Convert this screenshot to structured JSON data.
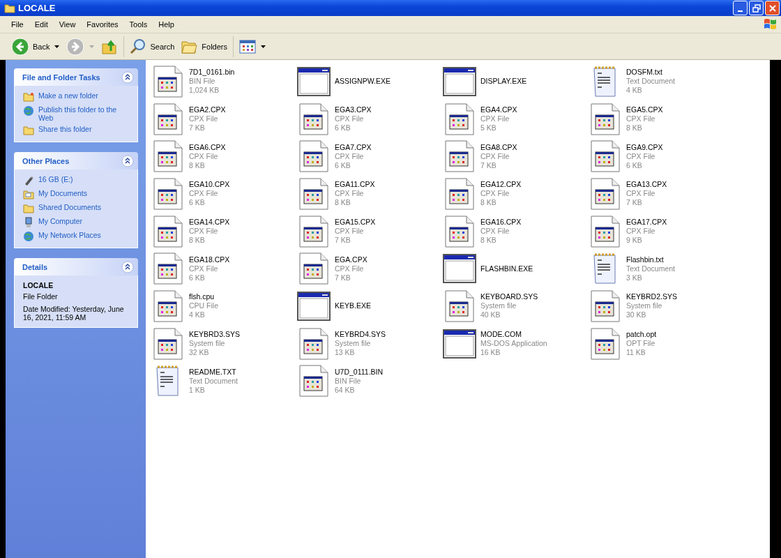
{
  "window": {
    "title": "LOCALE"
  },
  "menu": [
    "File",
    "Edit",
    "View",
    "Favorites",
    "Tools",
    "Help"
  ],
  "toolbar": [
    {
      "kind": "back",
      "label": "Back",
      "disabled": false
    },
    {
      "kind": "forward",
      "disabled": true
    },
    {
      "kind": "up"
    },
    {
      "kind": "search",
      "label": "Search"
    },
    {
      "kind": "folders",
      "label": "Folders"
    },
    {
      "kind": "views"
    }
  ],
  "sidebar": {
    "panels": [
      {
        "kind": "links",
        "title": "File and Folder Tasks",
        "items": [
          {
            "kind": "new-folder",
            "label": "Make a new folder"
          },
          {
            "kind": "publish",
            "label": "Publish this folder to the Web"
          },
          {
            "kind": "share",
            "label": "Share this folder"
          }
        ]
      },
      {
        "kind": "links",
        "title": "Other Places",
        "items": [
          {
            "kind": "drive",
            "label": "16 GB (E:)"
          },
          {
            "kind": "documents",
            "label": "My Documents"
          },
          {
            "kind": "shared",
            "label": "Shared Documents"
          },
          {
            "kind": "computer",
            "label": "My Computer"
          },
          {
            "kind": "network",
            "label": "My Network Places"
          }
        ]
      },
      {
        "kind": "details",
        "title": "Details",
        "name": "LOCALE",
        "type": "File Folder",
        "modified": "Date Modified: Yesterday, June 16, 2021, 11:59 AM"
      }
    ]
  },
  "files": [
    {
      "kind": "generic",
      "name": "7D1_0161.bin",
      "type": "BIN File",
      "size": "1,024 KB"
    },
    {
      "kind": "exe",
      "name": "ASSIGNPW.EXE"
    },
    {
      "kind": "exe",
      "name": "DISPLAY.EXE"
    },
    {
      "kind": "text",
      "name": "DOSFM.txt",
      "type": "Text Document",
      "size": "4 KB"
    },
    {
      "kind": "generic",
      "name": "EGA2.CPX",
      "type": "CPX File",
      "size": "7 KB"
    },
    {
      "kind": "generic",
      "name": "EGA3.CPX",
      "type": "CPX File",
      "size": "6 KB"
    },
    {
      "kind": "generic",
      "name": "EGA4.CPX",
      "type": "CPX File",
      "size": "5 KB"
    },
    {
      "kind": "generic",
      "name": "EGA5.CPX",
      "type": "CPX File",
      "size": "8 KB"
    },
    {
      "kind": "generic",
      "name": "EGA6.CPX",
      "type": "CPX File",
      "size": "8 KB"
    },
    {
      "kind": "generic",
      "name": "EGA7.CPX",
      "type": "CPX File",
      "size": "6 KB"
    },
    {
      "kind": "generic",
      "name": "EGA8.CPX",
      "type": "CPX File",
      "size": "7 KB"
    },
    {
      "kind": "generic",
      "name": "EGA9.CPX",
      "type": "CPX File",
      "size": "6 KB"
    },
    {
      "kind": "generic",
      "name": "EGA10.CPX",
      "type": "CPX File",
      "size": "6 KB"
    },
    {
      "kind": "generic",
      "name": "EGA11.CPX",
      "type": "CPX File",
      "size": "8 KB"
    },
    {
      "kind": "generic",
      "name": "EGA12.CPX",
      "type": "CPX File",
      "size": "8 KB"
    },
    {
      "kind": "generic",
      "name": "EGA13.CPX",
      "type": "CPX File",
      "size": "7 KB"
    },
    {
      "kind": "generic",
      "name": "EGA14.CPX",
      "type": "CPX File",
      "size": "8 KB"
    },
    {
      "kind": "generic",
      "name": "EGA15.CPX",
      "type": "CPX File",
      "size": "7 KB"
    },
    {
      "kind": "generic",
      "name": "EGA16.CPX",
      "type": "CPX File",
      "size": "8 KB"
    },
    {
      "kind": "generic",
      "name": "EGA17.CPX",
      "type": "CPX File",
      "size": "9 KB"
    },
    {
      "kind": "generic",
      "name": "EGA18.CPX",
      "type": "CPX File",
      "size": "6 KB"
    },
    {
      "kind": "generic",
      "name": "EGA.CPX",
      "type": "CPX File",
      "size": "7 KB"
    },
    {
      "kind": "exe",
      "name": "FLASHBIN.EXE"
    },
    {
      "kind": "text",
      "name": "Flashbin.txt",
      "type": "Text Document",
      "size": "3 KB"
    },
    {
      "kind": "generic",
      "name": "flsh.cpu",
      "type": "CPU File",
      "size": "4 KB"
    },
    {
      "kind": "exe",
      "name": "KEYB.EXE"
    },
    {
      "kind": "generic",
      "name": "KEYBOARD.SYS",
      "type": "System file",
      "size": "40 KB"
    },
    {
      "kind": "generic",
      "name": "KEYBRD2.SYS",
      "type": "System file",
      "size": "30 KB"
    },
    {
      "kind": "generic",
      "name": "KEYBRD3.SYS",
      "type": "System file",
      "size": "32 KB"
    },
    {
      "kind": "generic",
      "name": "KEYBRD4.SYS",
      "type": "System file",
      "size": "13 KB"
    },
    {
      "kind": "exe",
      "name": "MODE.COM",
      "type": "MS-DOS Application",
      "size": "16 KB"
    },
    {
      "kind": "generic",
      "name": "patch.opt",
      "type": "OPT File",
      "size": "11 KB"
    },
    {
      "kind": "text",
      "name": "README.TXT",
      "type": "Text Document",
      "size": "1 KB"
    },
    {
      "kind": "generic",
      "name": "U7D_0111.BIN",
      "type": "BIN File",
      "size": "64 KB"
    }
  ]
}
